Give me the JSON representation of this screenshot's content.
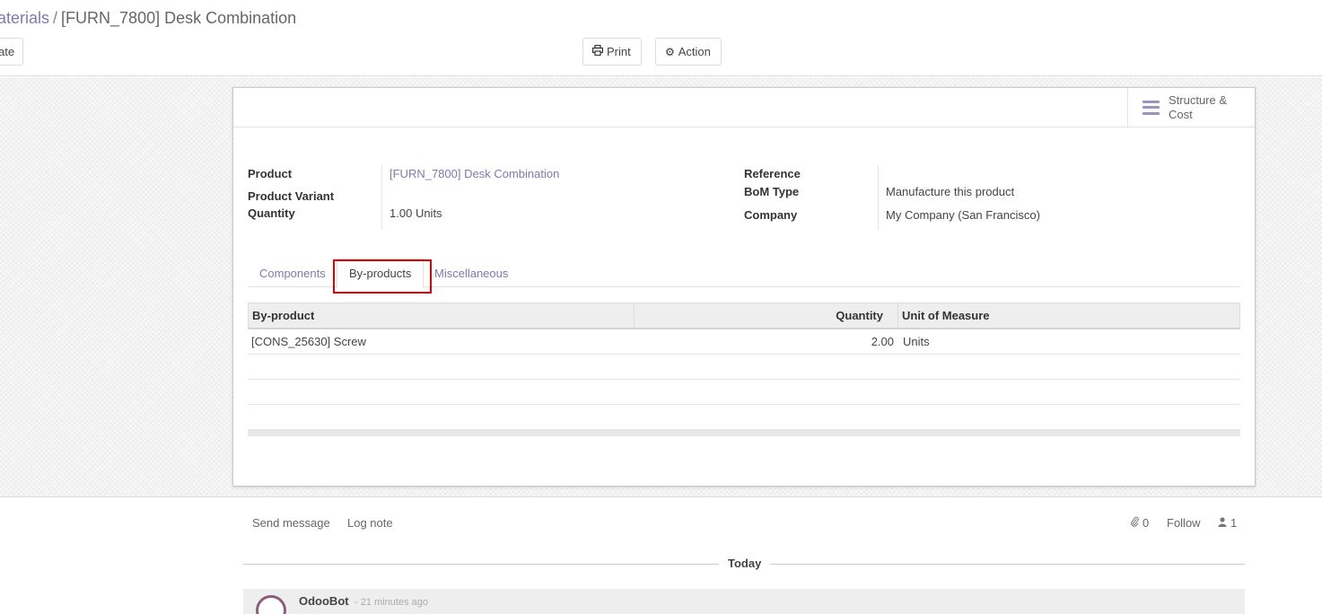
{
  "breadcrumb": {
    "parent": "aterials",
    "separator": "/",
    "current": "[FURN_7800] Desk Combination"
  },
  "toolbar": {
    "create_label": "ate",
    "print_label": "Print",
    "action_label": "Action",
    "print_icon": "print-icon",
    "action_icon": "gear-icon"
  },
  "smart_button": {
    "label": "Structure & Cost",
    "icon": "bars-icon"
  },
  "fields": {
    "product_label": "Product",
    "product_value": "[FURN_7800] Desk Combination",
    "variant_label": "Product Variant",
    "variant_value": "",
    "quantity_label": "Quantity",
    "quantity_value": "1.00",
    "quantity_uom": "Units",
    "reference_label": "Reference",
    "reference_value": "",
    "bom_type_label": "BoM Type",
    "bom_type_value": "Manufacture this product",
    "company_label": "Company",
    "company_value": "My Company (San Francisco)"
  },
  "tabs": [
    {
      "label": "Components"
    },
    {
      "label": "By-products"
    },
    {
      "label": "Miscellaneous"
    }
  ],
  "active_tab": "By-products",
  "table": {
    "headers": [
      "By-product",
      "Quantity",
      "Unit of Measure"
    ],
    "rows": [
      {
        "product": "[CONS_25630] Screw",
        "quantity": "2.00",
        "uom": "Units"
      }
    ]
  },
  "chatter": {
    "send_message": "Send message",
    "log_note": "Log note",
    "attachments_count": "0",
    "follow": "Follow",
    "followers_count": "1",
    "day_label": "Today",
    "author": "OdooBot",
    "time": "- 21 minutes ago"
  },
  "colors": {
    "link": "#7c7bad",
    "highlight": "#e00000"
  }
}
